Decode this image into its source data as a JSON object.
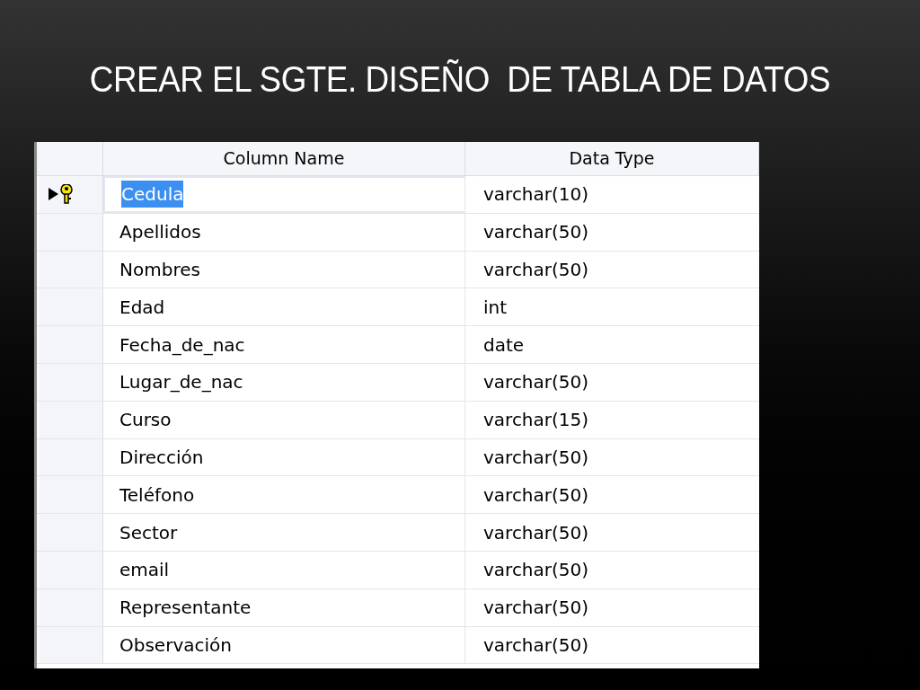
{
  "slide": {
    "title": "CREAR EL SGTE. DISEÑO  DE TABLA DE DATOS"
  },
  "table": {
    "columns": [
      "Column Name",
      "Data Type"
    ],
    "rows": [
      {
        "name": "Cedula",
        "type": "varchar(10)",
        "selected": true,
        "primary_key": true
      },
      {
        "name": "Apellidos",
        "type": "varchar(50)",
        "selected": false,
        "primary_key": false
      },
      {
        "name": "Nombres",
        "type": "varchar(50)",
        "selected": false,
        "primary_key": false
      },
      {
        "name": "Edad",
        "type": "int",
        "selected": false,
        "primary_key": false
      },
      {
        "name": "Fecha_de_nac",
        "type": "date",
        "selected": false,
        "primary_key": false
      },
      {
        "name": "Lugar_de_nac",
        "type": "varchar(50)",
        "selected": false,
        "primary_key": false
      },
      {
        "name": "Curso",
        "type": "varchar(15)",
        "selected": false,
        "primary_key": false
      },
      {
        "name": "Dirección",
        "type": "varchar(50)",
        "selected": false,
        "primary_key": false
      },
      {
        "name": "Teléfono",
        "type": "varchar(50)",
        "selected": false,
        "primary_key": false
      },
      {
        "name": "Sector",
        "type": "varchar(50)",
        "selected": false,
        "primary_key": false
      },
      {
        "name": "email",
        "type": "varchar(50)",
        "selected": false,
        "primary_key": false
      },
      {
        "name": "Representante",
        "type": "varchar(50)",
        "selected": false,
        "primary_key": false
      },
      {
        "name": "Observación",
        "type": "varchar(50)",
        "selected": false,
        "primary_key": false
      }
    ]
  }
}
